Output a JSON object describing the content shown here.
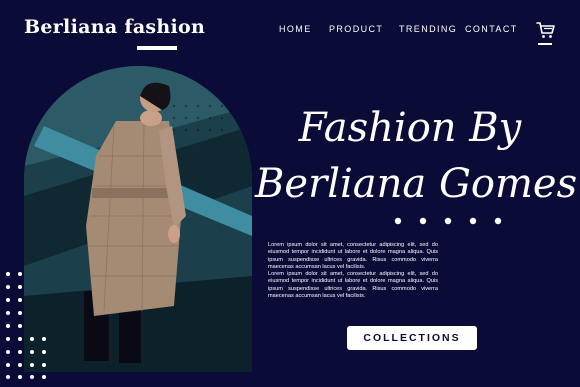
{
  "header": {
    "brand": "Berliana fashion",
    "nav": [
      "HOME",
      "PRODUCT",
      "TRENDING",
      "CONTACT"
    ],
    "cart_icon": "cart-icon"
  },
  "hero": {
    "headline_line1": "Fashion By",
    "headline_line2": "Berliana Gomes",
    "paragraph_1": "Lorem ipsum dolor sit amet, consectetur adipiscing elit, sed do eiusmod tempor incididunt ut labore et dolore magna aliqua. Quis ipsum suspendisse ultrices gravida. Risus commodo viverra maecenas accumsan lacus vel facilisis.",
    "paragraph_2": "Lorem ipsum dolor sit amet, consectetur adipiscing elit, sed do eiusmod tempor incididunt ut labore et dolore magna aliqua. Quis ipsum suspendisse ultrices gravida. Risus commodo viverra maecenas accumsan lacus vel facilisis.",
    "cta_label": "COLLECTIONS",
    "photo": "fashion-model-photo"
  },
  "colors": {
    "background": "#0b0b38",
    "text": "#ffffff",
    "button_bg": "#ffffff",
    "button_text": "#0b0b38",
    "photo_teal": "#17343f"
  }
}
